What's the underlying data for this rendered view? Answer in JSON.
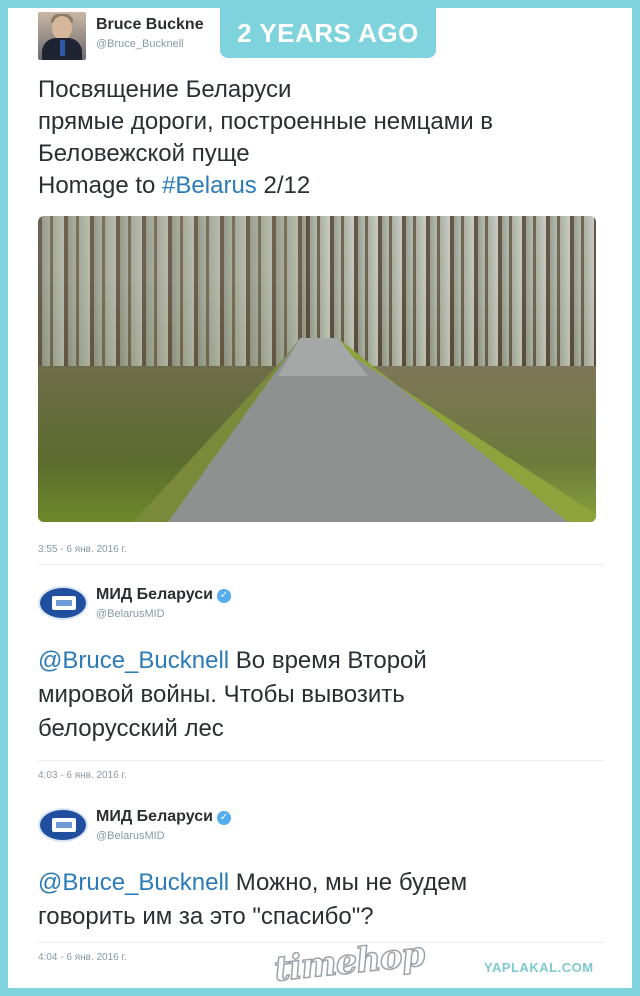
{
  "badge": {
    "text": "2 YEARS AGO"
  },
  "tweet1": {
    "user_name": "Bruce Buckne",
    "user_handle": "@Bruce_Bucknell",
    "lines": [
      "Посвящение Беларуси",
      "прямые дороги, построенные немцами в",
      "Беловежской пуще"
    ],
    "last_line_prefix": "Homage to ",
    "hashtag": "#Belarus",
    "last_line_suffix": " 2/12",
    "timestamp": "3:55 - 6 янв. 2016 г."
  },
  "reply1": {
    "user_name": "МИД Беларуси",
    "user_handle": "@BelarusMID",
    "mention": "@Bruce_Bucknell",
    "line1_rest": " Во время Второй",
    "line2": "мировой войны. Чтобы вывозить",
    "line3": "белорусский лес",
    "timestamp": "4:03 - 6 янв. 2016 г."
  },
  "reply2": {
    "user_name": "МИД Беларуси",
    "user_handle": "@BelarusMID",
    "mention": "@Bruce_Bucknell",
    "line1_rest": " Можно, мы не будем",
    "line2": "говорить им за это \"спасибо\"?",
    "timestamp": "4:04 - 6 янв. 2016 г."
  },
  "watermarks": {
    "timehop": "timehop",
    "yaplakal": "YAPLAKAL.COM"
  },
  "colors": {
    "frame": "#7fd3dc",
    "link": "#2b7bb9",
    "text": "#292f33",
    "muted": "#8899a6",
    "verified": "#55acee"
  },
  "icons": {
    "verified": "verified-badge-icon",
    "mid_logo": "ministry-logo-icon"
  }
}
